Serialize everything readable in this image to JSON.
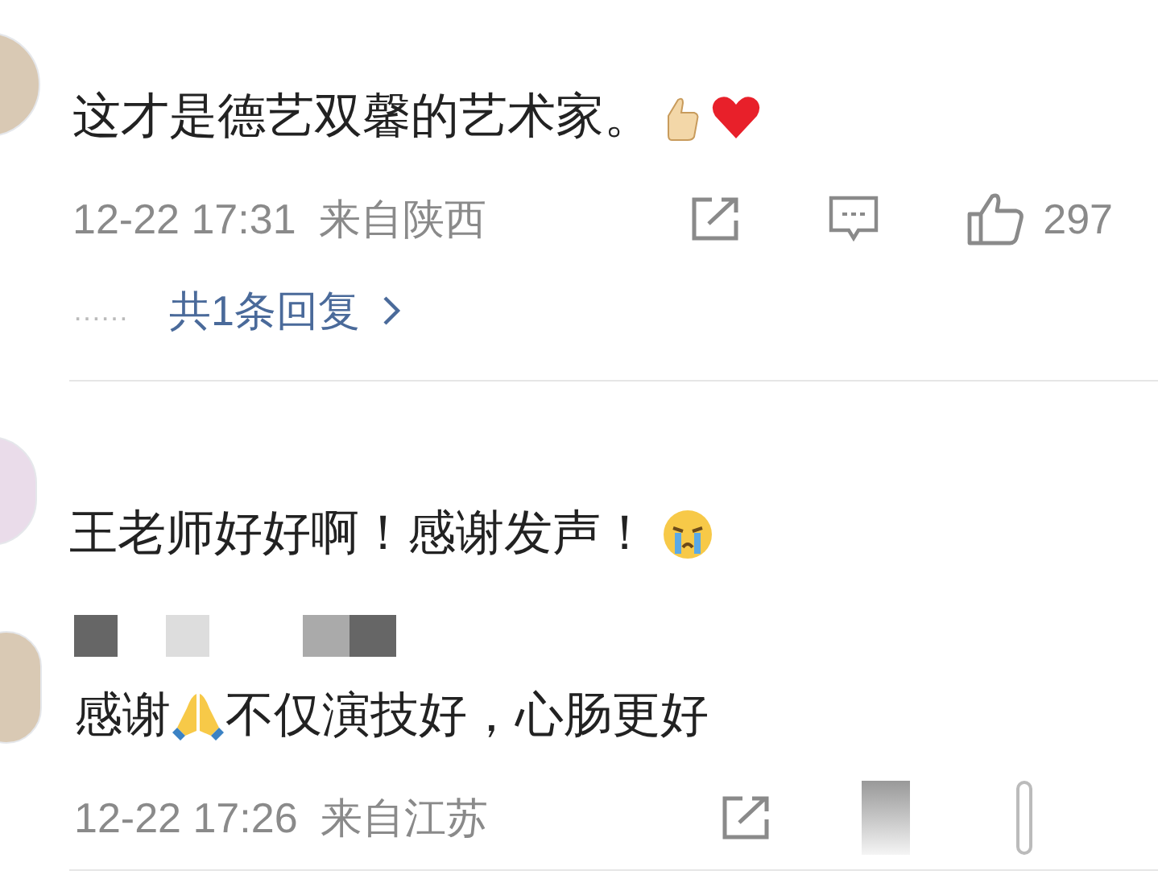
{
  "comments": [
    {
      "avatar_faded": false,
      "content": [
        {
          "kind": "text",
          "text": "这才是德艺双馨的艺术家。"
        },
        {
          "kind": "thumbs_up"
        },
        {
          "kind": "heart"
        }
      ],
      "time": "12-22 17:31",
      "location": "来自陕西",
      "likes": "297",
      "actions_blurred": false,
      "replies": "共1条回复",
      "reply_dots": "……"
    },
    {
      "avatar_faded": true,
      "content": [
        {
          "kind": "text",
          "text": "王老师好好啊！感谢发声！"
        },
        {
          "kind": "crying_face"
        }
      ]
    },
    {
      "avatar_faded": false,
      "name_redacted": true,
      "content": [
        {
          "kind": "text",
          "text": "感谢"
        },
        {
          "kind": "folded_hands"
        },
        {
          "kind": "text",
          "text": "不仅演技好，心肠更好"
        }
      ],
      "time": "12-22 17:26",
      "location": "来自江苏",
      "actions_blurred": true
    }
  ]
}
